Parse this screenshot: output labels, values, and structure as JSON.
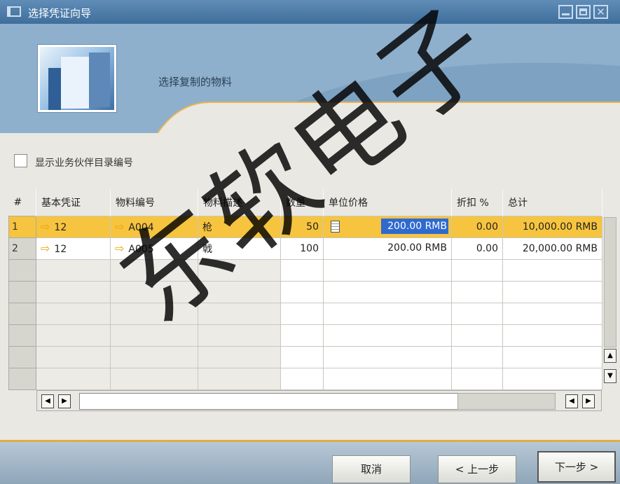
{
  "window": {
    "title": "选择凭证向导"
  },
  "header": {
    "subtitle": "选择复制的物料"
  },
  "options": {
    "show_bp_catalog_label": "显示业务伙伴目录编号"
  },
  "table": {
    "columns": [
      "#",
      "基本凭证",
      "物料编号",
      "物料描述",
      "数量",
      "单位价格",
      "折扣 %",
      "总计"
    ],
    "rows": [
      {
        "num": "1",
        "base_doc": "12",
        "item_no": "A004",
        "desc": "枪",
        "qty": "50",
        "unit_price": "200.00 RMB",
        "discount": "0.00",
        "total": "10,000.00 RMB"
      },
      {
        "num": "2",
        "base_doc": "12",
        "item_no": "A005",
        "desc": "戟",
        "qty": "100",
        "unit_price": "200.00 RMB",
        "discount": "0.00",
        "total": "20,000.00 RMB"
      }
    ]
  },
  "footer": {
    "cancel": "取消",
    "prev": "< 上一步",
    "next": "下一步 >"
  },
  "watermark": "东软电子",
  "colors": {
    "selected_row": "#f6c43e",
    "title_bar": "#4f7eab",
    "footer_accent": "#e8aa44"
  }
}
